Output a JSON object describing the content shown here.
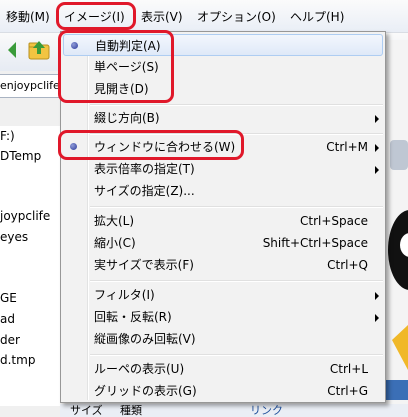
{
  "menubar": {
    "items": [
      "移動(M)",
      "イメージ(I)",
      "表示(V)",
      "オプション(O)",
      "ヘルプ(H)"
    ]
  },
  "address": {
    "value": "enjoypclife"
  },
  "tree": {
    "items": [
      "F:)",
      "DTemp",
      "joypclife",
      "eyes",
      "GE",
      "ad",
      "der",
      "d.tmp"
    ]
  },
  "status": {
    "col1": "サイズ",
    "col2": "種類"
  },
  "right_pane": {
    "label": "リンク"
  },
  "menu": {
    "items": [
      {
        "label": "自動判定(A)",
        "checked": true
      },
      {
        "label": "単ページ(S)"
      },
      {
        "label": "見開き(D)"
      },
      {
        "label": "綴じ方向(B)",
        "submenu": true
      },
      {
        "label": "ウィンドウに合わせる(W)",
        "accel": "Ctrl+M",
        "checked": true,
        "submenu": true
      },
      {
        "label": "表示倍率の指定(T)",
        "submenu": true
      },
      {
        "label": "サイズの指定(Z)..."
      },
      {
        "label": "拡大(L)",
        "accel": "Ctrl+Space"
      },
      {
        "label": "縮小(C)",
        "accel": "Shift+Ctrl+Space"
      },
      {
        "label": "実サイズで表示(F)",
        "accel": "Ctrl+Q"
      },
      {
        "label": "フィルタ(I)",
        "submenu": true
      },
      {
        "label": "回転・反転(R)",
        "submenu": true
      },
      {
        "label": "縦画像のみ回転(V)"
      },
      {
        "label": "ルーペの表示(U)",
        "accel": "Ctrl+L"
      },
      {
        "label": "グリッドの表示(G)",
        "accel": "Ctrl+G"
      }
    ]
  },
  "colors": {
    "annotation": "#e0182a",
    "highlight_border": "#aecdf2",
    "radio_dot": "#2c3a9a"
  }
}
